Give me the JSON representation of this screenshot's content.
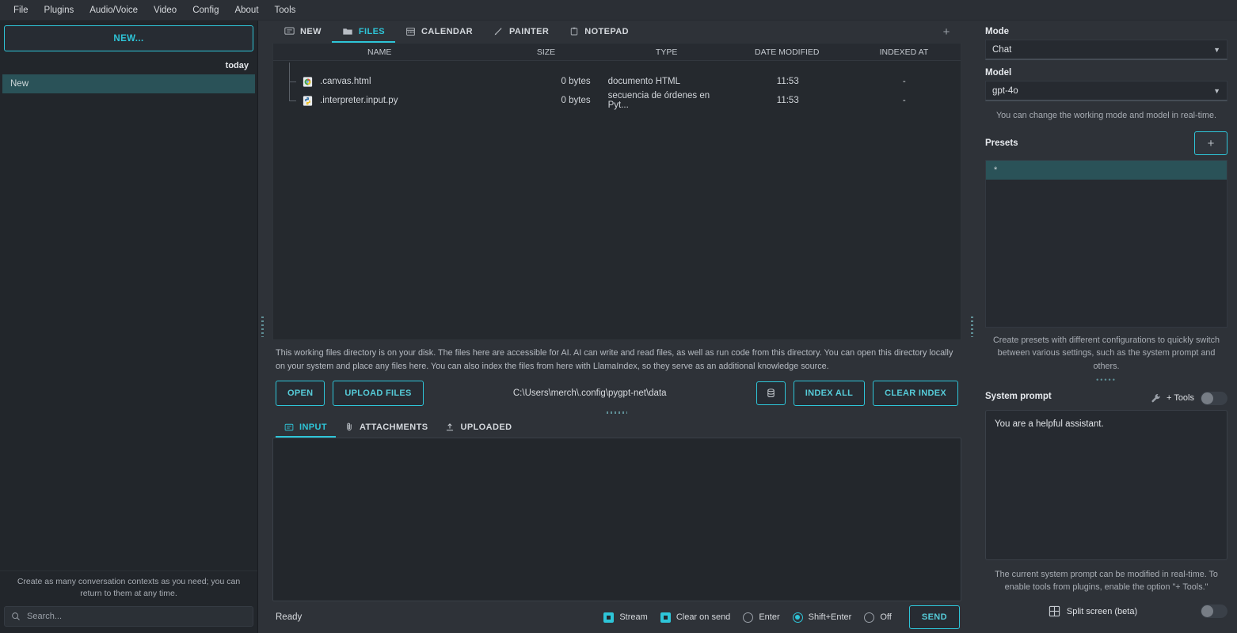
{
  "menubar": {
    "items": [
      "File",
      "Plugins",
      "Audio/Voice",
      "Video",
      "Config",
      "About",
      "Tools"
    ]
  },
  "sidebar": {
    "new_button": "NEW...",
    "day_label": "today",
    "contexts": [
      {
        "label": "New"
      }
    ],
    "hint": "Create as many conversation contexts as you need; you can return to them at any time.",
    "search_placeholder": "Search..."
  },
  "tabs": [
    {
      "label": "NEW",
      "icon": "chat-bubble-icon",
      "active": false
    },
    {
      "label": "FILES",
      "icon": "folder-icon",
      "active": true
    },
    {
      "label": "CALENDAR",
      "icon": "calendar-icon",
      "active": false
    },
    {
      "label": "PAINTER",
      "icon": "brush-icon",
      "active": false
    },
    {
      "label": "NOTEPAD",
      "icon": "clipboard-icon",
      "active": false
    }
  ],
  "add_tab_label": "+",
  "files": {
    "columns": [
      "NAME",
      "SIZE",
      "TYPE",
      "DATE MODIFIED",
      "INDEXED AT"
    ],
    "rows": [
      {
        "name": ".canvas.html",
        "size": "0 bytes",
        "type": "documento HTML",
        "date": "11:53",
        "indexed": "-",
        "icon": "html-file-icon"
      },
      {
        "name": ".interpreter.input.py",
        "size": "0 bytes",
        "type": "secuencia de órdenes en Pyt...",
        "date": "11:53",
        "indexed": "-",
        "icon": "python-file-icon"
      }
    ],
    "description": "This working files directory is on your disk. The files here are accessible for AI. AI can write and read files, as well as run code from this directory. You can open this directory locally on your system and place any files here. You can also index the files from here with LlamaIndex, so they serve as an additional knowledge source.",
    "open_label": "OPEN",
    "upload_label": "UPLOAD FILES",
    "path": "C:\\Users\\merch\\.config\\pygpt-net\\data",
    "db_icon": "database-icon",
    "index_all_label": "INDEX ALL",
    "clear_index_label": "CLEAR INDEX"
  },
  "input_tabs": [
    {
      "label": "INPUT",
      "icon": "input-icon",
      "active": true
    },
    {
      "label": "ATTACHMENTS",
      "icon": "paperclip-icon",
      "active": false
    },
    {
      "label": "UPLOADED",
      "icon": "upload-icon",
      "active": false
    }
  ],
  "input_value": "",
  "status": {
    "text": "Ready",
    "stream_label": "Stream",
    "stream_checked": true,
    "clear_label": "Clear on send",
    "clear_checked": true,
    "send_modes": [
      {
        "label": "Enter",
        "selected": false
      },
      {
        "label": "Shift+Enter",
        "selected": true
      },
      {
        "label": "Off",
        "selected": false
      }
    ],
    "send_label": "SEND"
  },
  "right": {
    "mode_label": "Mode",
    "mode_value": "Chat",
    "model_label": "Model",
    "model_value": "gpt-4o",
    "mode_hint": "You can change the working mode and model in real-time.",
    "presets_label": "Presets",
    "presets_add": "+",
    "presets": [
      {
        "label": "*"
      }
    ],
    "presets_hint": "Create presets with different configurations to quickly switch between various settings, such as the system prompt and others.",
    "system_prompt_label": "System prompt",
    "tools_icon": "wrench-icon",
    "tools_label": "+ Tools",
    "tools_enabled": false,
    "system_prompt_value": "You are a helpful assistant.",
    "system_prompt_hint": "The current system prompt can be modified in real-time. To enable tools from plugins, enable the option \"+ Tools.\"",
    "split_icon": "grid-icon",
    "split_label": "Split screen (beta)",
    "split_enabled": false
  },
  "colors": {
    "accent": "#2ec5d8",
    "selection": "#2a5258",
    "bg": "#2e3238",
    "panel": "#25292e"
  }
}
